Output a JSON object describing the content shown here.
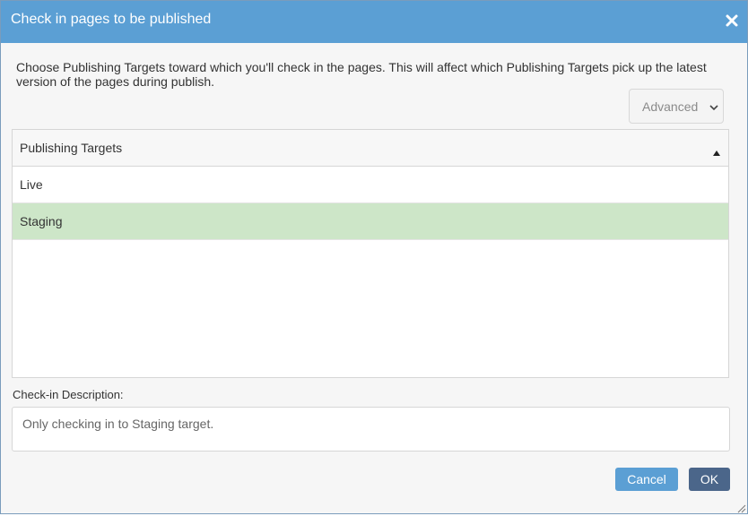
{
  "dialog": {
    "title": "Check in pages to be published",
    "close_icon": "close-icon",
    "intro_text": "Choose Publishing Targets toward which you'll check in the pages. This will affect which Publishing Targets pick up the latest version of the pages during publish.",
    "mode_select": {
      "selected": "Advanced",
      "icon": "chevron-down-icon"
    },
    "targets_grid": {
      "header": "Publishing Targets",
      "sort_icon": "sort-ascending-icon",
      "rows": [
        {
          "label": "Live",
          "selected": false
        },
        {
          "label": "Staging",
          "selected": true
        }
      ]
    },
    "description": {
      "label": "Check-in Description:",
      "value": "Only checking in to Staging target."
    },
    "buttons": {
      "cancel": "Cancel",
      "ok": "OK"
    }
  },
  "colors": {
    "titlebar": "#5b9fd4",
    "selected_row": "#cde6c8",
    "cancel_button": "#5b9fd4",
    "ok_button": "#4b668a"
  }
}
